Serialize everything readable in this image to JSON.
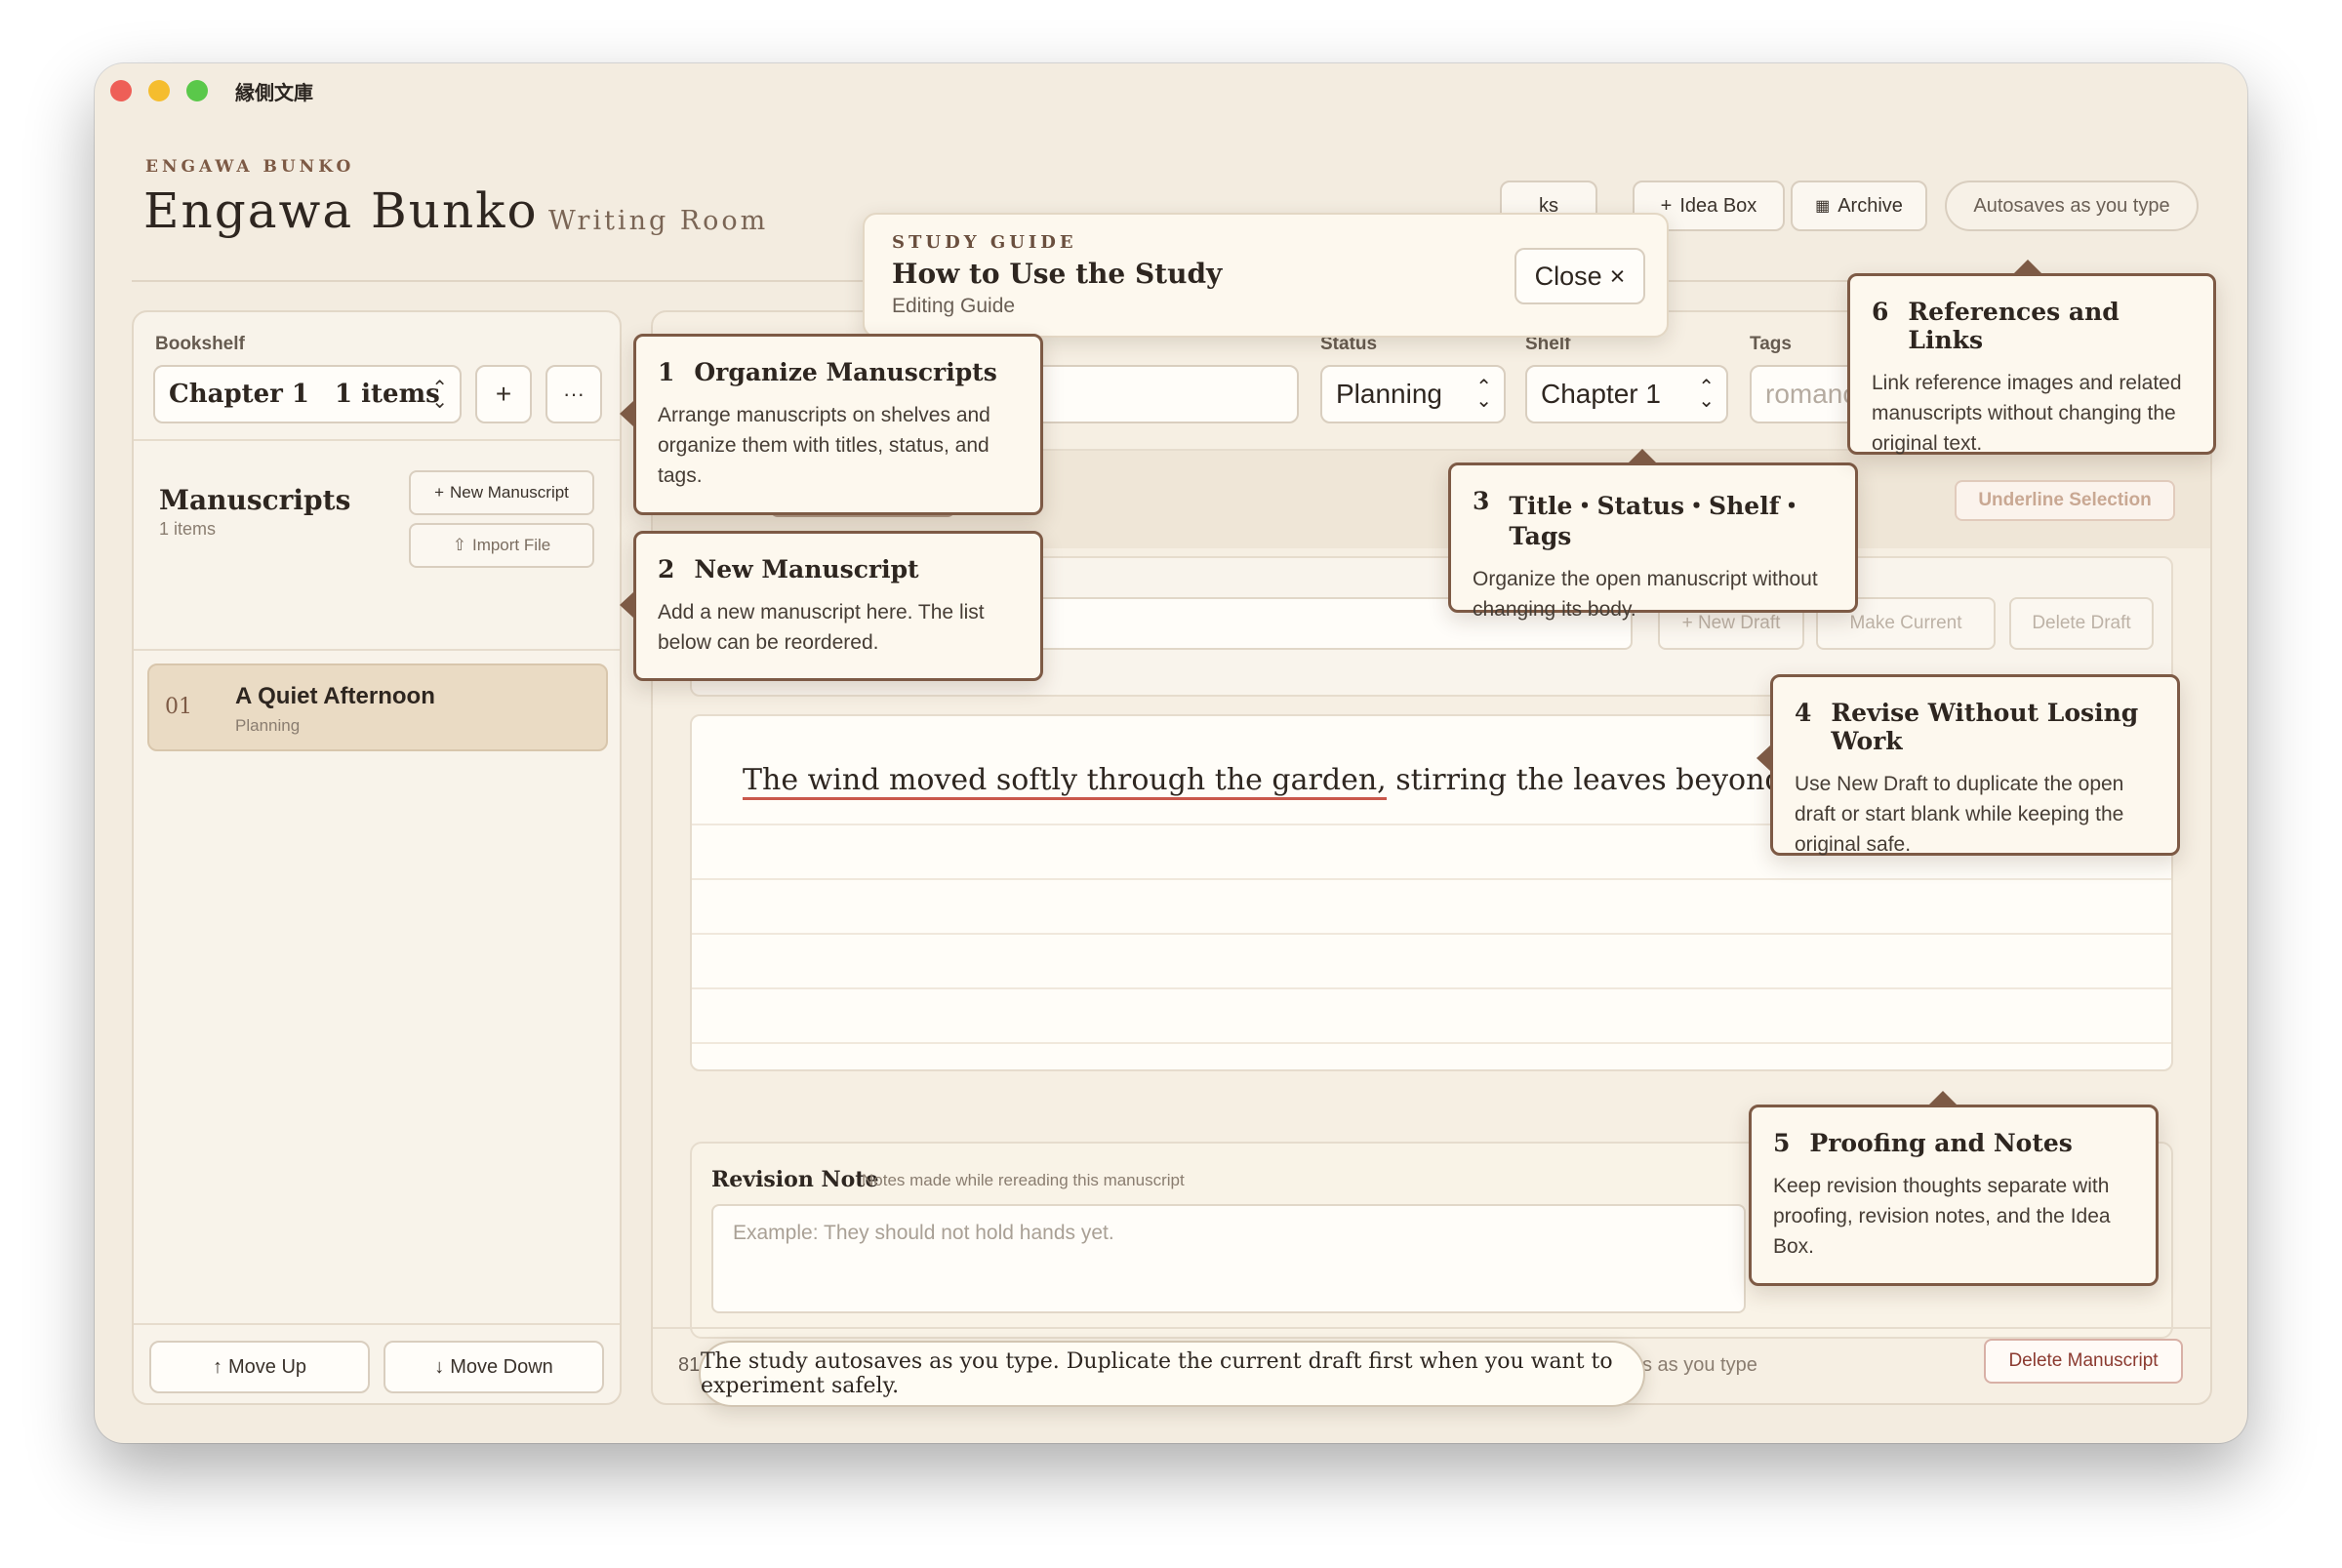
{
  "window": {
    "title": "縁側文庫"
  },
  "brand": {
    "kicker": "ENGAWA BUNKO",
    "title": "Engawa Bunko",
    "subtitle": "Writing Room"
  },
  "header": {
    "links_label": "ks",
    "idea_box_label": "Idea Box",
    "archive_label": "Archive",
    "autosave_pill": "Autosaves as you type"
  },
  "study_guide": {
    "kicker": "STUDY GUIDE",
    "title": "How to Use the Study",
    "subtitle": "Editing Guide",
    "close_label": "Close"
  },
  "sidebar": {
    "bookshelf_label": "Bookshelf",
    "bookshelf_selected": "Chapter 1",
    "bookshelf_count": "1 items",
    "manuscripts_title": "Manuscripts",
    "manuscripts_count": "1 items",
    "new_manuscript_label": "New Manuscript",
    "import_label": "Import File",
    "items": [
      {
        "number": "01",
        "title": "A Quiet Afternoon",
        "status": "Planning"
      }
    ],
    "move_up_label": "Move Up",
    "move_down_label": "Move Down"
  },
  "main": {
    "status_label": "Status",
    "status_value": "Planning",
    "shelf_label": "Shelf",
    "shelf_value": "Chapter 1",
    "tags_label": "Tags",
    "tags_placeholder": "romanc",
    "underline_label": "Underline Selection",
    "new_draft_label": "+ New Draft",
    "make_current_label": "Make Current",
    "delete_draft_label": "Delete Draft",
    "editor_text_underlined": "The wind moved softly through the garden,",
    "editor_text_rest": " stirring the leaves beyond the veran",
    "revision_title": "Revision Note",
    "revision_sub": "Notes made while rereading this manuscript",
    "revision_placeholder": "Example: They should not hold hands yet.",
    "footer_count": "81",
    "footer_autosave": "s as you type",
    "delete_manuscript_label": "Delete Manuscript"
  },
  "tips": [
    {
      "number": "1",
      "title": "Organize Manuscripts",
      "body": "Arrange manuscripts on shelves and organize them with titles, status, and tags."
    },
    {
      "number": "2",
      "title": "New Manuscript",
      "body": "Add a new manuscript here. The list below can be reordered."
    },
    {
      "number": "3",
      "title": "Title・Status・Shelf・Tags",
      "body": "Organize the open manuscript without changing its body."
    },
    {
      "number": "4",
      "title": "Revise Without Losing Work",
      "body": "Use New Draft to duplicate the open draft or start blank while keeping the original safe."
    },
    {
      "number": "5",
      "title": "Proofing and Notes",
      "body": "Keep revision thoughts separate with proofing, revision notes, and the Idea Box."
    },
    {
      "number": "6",
      "title": "References and Links",
      "body": "Link reference images and related manuscripts without changing the original text."
    }
  ],
  "toast": "The study autosaves as you type. Duplicate the current draft first when you want to experiment safely.",
  "icons": {
    "plus": "+",
    "more": "···",
    "close": "×",
    "up": "↑",
    "down": "↓",
    "chevron": "⌃⌄",
    "import": "⇧",
    "archive": "▦"
  },
  "colors": {
    "accent": "#7d5a45",
    "background": "#f3ece0",
    "underline": "#c9574b"
  }
}
